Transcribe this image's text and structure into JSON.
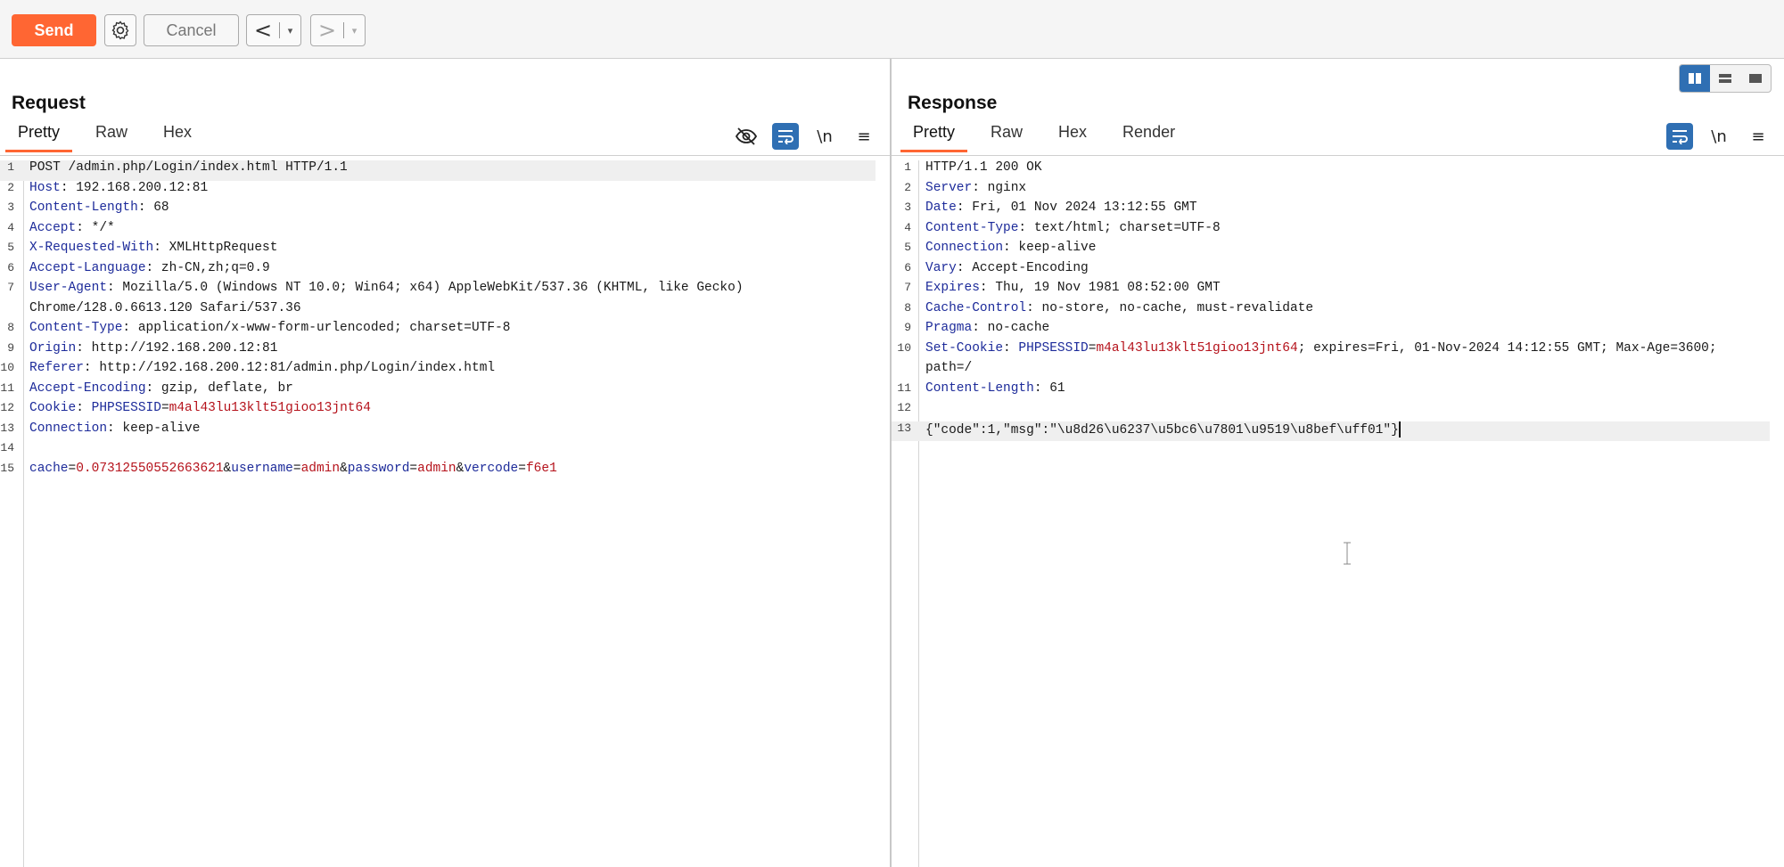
{
  "toolbar": {
    "send_label": "Send",
    "cancel_label": "Cancel",
    "back_label": "<",
    "forward_label": ">",
    "dropdown_glyph": "▾"
  },
  "layout": {
    "options": [
      "side-by-side",
      "horizontal",
      "single"
    ],
    "selected": "side-by-side"
  },
  "request": {
    "title": "Request",
    "tabs": [
      "Pretty",
      "Raw",
      "Hex"
    ],
    "active_tab": "Pretty",
    "tools": {
      "wrap": "\\n",
      "menu": "≡"
    },
    "lines": [
      {
        "n": "1",
        "parts": [
          {
            "t": "POST /admin.php/Login/index.html HTTP/1.1",
            "c": "v"
          }
        ]
      },
      {
        "n": "2",
        "parts": [
          {
            "t": "Host",
            "c": "k"
          },
          {
            "t": ": 192.168.200.12:81",
            "c": "v"
          }
        ]
      },
      {
        "n": "3",
        "parts": [
          {
            "t": "Content-Length",
            "c": "k"
          },
          {
            "t": ": 68",
            "c": "v"
          }
        ]
      },
      {
        "n": "4",
        "parts": [
          {
            "t": "Accept",
            "c": "k"
          },
          {
            "t": ": */*",
            "c": "v"
          }
        ]
      },
      {
        "n": "5",
        "parts": [
          {
            "t": "X-Requested-With",
            "c": "k"
          },
          {
            "t": ": XMLHttpRequest",
            "c": "v"
          }
        ]
      },
      {
        "n": "6",
        "parts": [
          {
            "t": "Accept-Language",
            "c": "k"
          },
          {
            "t": ": zh-CN,zh;q=0.9",
            "c": "v"
          }
        ]
      },
      {
        "n": "7",
        "parts": [
          {
            "t": "User-Agent",
            "c": "k"
          },
          {
            "t": ": Mozilla/5.0 (Windows NT 10.0; Win64; x64) AppleWebKit/537.36 (KHTML, like Gecko)",
            "c": "v"
          }
        ]
      },
      {
        "n": "",
        "parts": [
          {
            "t": "Chrome/128.0.6613.120 Safari/537.36",
            "c": "v"
          }
        ]
      },
      {
        "n": "8",
        "parts": [
          {
            "t": "Content-Type",
            "c": "k"
          },
          {
            "t": ": application/x-www-form-urlencoded; charset=UTF-8",
            "c": "v"
          }
        ]
      },
      {
        "n": "9",
        "parts": [
          {
            "t": "Origin",
            "c": "k"
          },
          {
            "t": ": http://192.168.200.12:81",
            "c": "v"
          }
        ]
      },
      {
        "n": "10",
        "parts": [
          {
            "t": "Referer",
            "c": "k"
          },
          {
            "t": ": http://192.168.200.12:81/admin.php/Login/index.html",
            "c": "v"
          }
        ]
      },
      {
        "n": "11",
        "parts": [
          {
            "t": "Accept-Encoding",
            "c": "k"
          },
          {
            "t": ": gzip, deflate, br",
            "c": "v"
          }
        ]
      },
      {
        "n": "12",
        "parts": [
          {
            "t": "Cookie",
            "c": "k"
          },
          {
            "t": ": ",
            "c": "v"
          },
          {
            "t": "PHPSESSID",
            "c": "k"
          },
          {
            "t": "=",
            "c": "v"
          },
          {
            "t": "m4al43lu13klt51gioo13jnt64",
            "c": "r"
          }
        ]
      },
      {
        "n": "13",
        "parts": [
          {
            "t": "Connection",
            "c": "k"
          },
          {
            "t": ": keep-alive",
            "c": "v"
          }
        ]
      },
      {
        "n": "14",
        "parts": []
      },
      {
        "n": "15",
        "parts": [
          {
            "t": "cache",
            "c": "k"
          },
          {
            "t": "=",
            "c": "v"
          },
          {
            "t": "0.07312550552663621",
            "c": "r"
          },
          {
            "t": "&",
            "c": "v"
          },
          {
            "t": "username",
            "c": "k"
          },
          {
            "t": "=",
            "c": "v"
          },
          {
            "t": "admin",
            "c": "r"
          },
          {
            "t": "&",
            "c": "v"
          },
          {
            "t": "password",
            "c": "k"
          },
          {
            "t": "=",
            "c": "v"
          },
          {
            "t": "admin",
            "c": "r"
          },
          {
            "t": "&",
            "c": "v"
          },
          {
            "t": "vercode",
            "c": "k"
          },
          {
            "t": "=",
            "c": "v"
          },
          {
            "t": "f6e1",
            "c": "r"
          }
        ]
      }
    ]
  },
  "response": {
    "title": "Response",
    "tabs": [
      "Pretty",
      "Raw",
      "Hex",
      "Render"
    ],
    "active_tab": "Pretty",
    "tools": {
      "wrap": "\\n",
      "menu": "≡"
    },
    "lines": [
      {
        "n": "1",
        "parts": [
          {
            "t": "HTTP/1.1 200 OK",
            "c": "v"
          }
        ]
      },
      {
        "n": "2",
        "parts": [
          {
            "t": "Server",
            "c": "k"
          },
          {
            "t": ": nginx",
            "c": "v"
          }
        ]
      },
      {
        "n": "3",
        "parts": [
          {
            "t": "Date",
            "c": "k"
          },
          {
            "t": ": Fri, 01 Nov 2024 13:12:55 GMT",
            "c": "v"
          }
        ]
      },
      {
        "n": "4",
        "parts": [
          {
            "t": "Content-Type",
            "c": "k"
          },
          {
            "t": ": text/html; charset=UTF-8",
            "c": "v"
          }
        ]
      },
      {
        "n": "5",
        "parts": [
          {
            "t": "Connection",
            "c": "k"
          },
          {
            "t": ": keep-alive",
            "c": "v"
          }
        ]
      },
      {
        "n": "6",
        "parts": [
          {
            "t": "Vary",
            "c": "k"
          },
          {
            "t": ": Accept-Encoding",
            "c": "v"
          }
        ]
      },
      {
        "n": "7",
        "parts": [
          {
            "t": "Expires",
            "c": "k"
          },
          {
            "t": ": Thu, 19 Nov 1981 08:52:00 GMT",
            "c": "v"
          }
        ]
      },
      {
        "n": "8",
        "parts": [
          {
            "t": "Cache-Control",
            "c": "k"
          },
          {
            "t": ": no-store, no-cache, must-revalidate",
            "c": "v"
          }
        ]
      },
      {
        "n": "9",
        "parts": [
          {
            "t": "Pragma",
            "c": "k"
          },
          {
            "t": ": no-cache",
            "c": "v"
          }
        ]
      },
      {
        "n": "10",
        "parts": [
          {
            "t": "Set-Cookie",
            "c": "k"
          },
          {
            "t": ": ",
            "c": "v"
          },
          {
            "t": "PHPSESSID",
            "c": "k"
          },
          {
            "t": "=",
            "c": "v"
          },
          {
            "t": "m4al43lu13klt51gioo13jnt64",
            "c": "r"
          },
          {
            "t": "; expires=Fri, 01-Nov-2024 14:12:55 GMT; Max-Age=3600;",
            "c": "v"
          }
        ]
      },
      {
        "n": "",
        "parts": [
          {
            "t": "path=/",
            "c": "v"
          }
        ]
      },
      {
        "n": "11",
        "parts": [
          {
            "t": "Content-Length",
            "c": "k"
          },
          {
            "t": ": 61",
            "c": "v"
          }
        ]
      },
      {
        "n": "12",
        "parts": []
      },
      {
        "n": "13",
        "parts": [
          {
            "t": "{\"code\":1,\"msg\":\"\\u8d26\\u6237\\u5bc6\\u7801\\u9519\\u8bef\\uff01\"}",
            "c": "v"
          }
        ]
      }
    ]
  },
  "colors": {
    "send": "#ff6633",
    "accent": "#2f6fb3",
    "key": "#1d2b9a",
    "value_red": "#b5121b"
  }
}
